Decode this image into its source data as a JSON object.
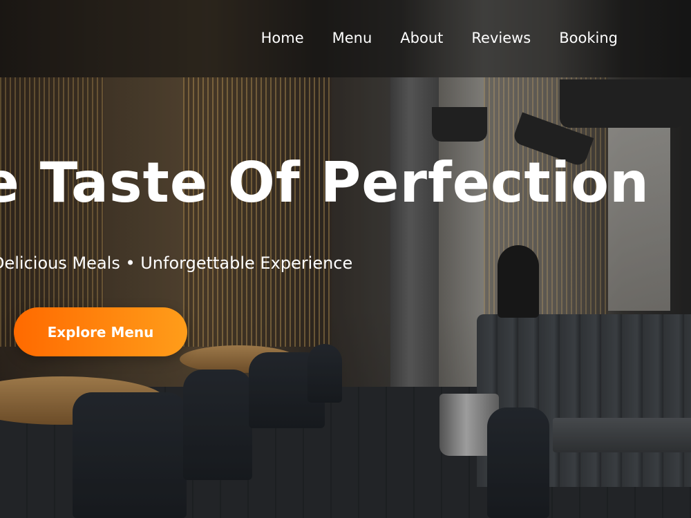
{
  "nav": {
    "items": [
      {
        "label": "Home"
      },
      {
        "label": "Menu"
      },
      {
        "label": "About"
      },
      {
        "label": "Reviews"
      },
      {
        "label": "Booking"
      }
    ]
  },
  "hero": {
    "title": "The Taste Of Perfection",
    "subtitle": "Delicious Meals • Unforgettable Experience",
    "cta_label": "Explore Menu"
  },
  "colors": {
    "accent_start": "#ff6a00",
    "accent_end": "#ff9d1a",
    "text": "#ffffff"
  }
}
